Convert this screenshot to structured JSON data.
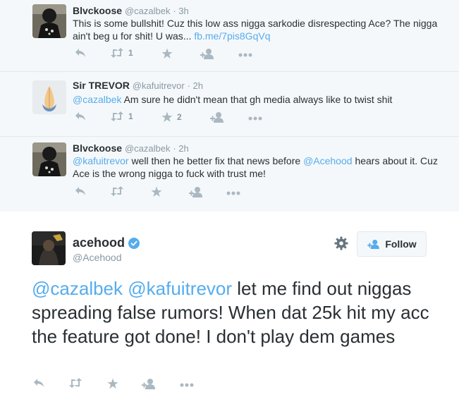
{
  "replies": [
    {
      "name": "Blvckoose",
      "handle": "@cazalbek",
      "time": "· 3h",
      "text_before": "This is some bullshit! Cuz this low ass nigga sarkodie disrespecting Ace? The nigga ain't beg u for shit! U was...",
      "link": "fb.me/7pis8GqVq",
      "retweets": "1",
      "favorites": ""
    },
    {
      "name": "Sir TREVOR",
      "handle": "@kafuitrevor",
      "time": "· 2h",
      "mention": "@cazalbek",
      "text": "Am sure he didn't mean that gh media always like to twist shit",
      "retweets": "1",
      "favorites": "2"
    },
    {
      "name": "Blvckoose",
      "handle": "@cazalbek",
      "time": "· 2h",
      "mention1": "@kafuitrevor",
      "text_mid": "well then he better fix that news before",
      "mention2": "@Acehood",
      "text_end": "hears about it. Cuz Ace is the wrong nigga to fuck with trust me!",
      "retweets": "",
      "favorites": ""
    }
  ],
  "main": {
    "name": "acehood",
    "handle": "@Acehood",
    "follow_label": "Follow",
    "mention1": "@cazalbek",
    "mention2": "@kafuitrevor",
    "text": "let me find out niggas spreading false rumors! When dat 25k hit my acc the feature got done! I don't play dem games"
  },
  "icons": {
    "reply": "reply-icon",
    "retweet": "retweet-icon",
    "favorite": "star-icon",
    "follow": "add-user-icon",
    "more": "more-icon",
    "gear": "gear-icon",
    "verified": "verified-badge-icon"
  },
  "colors": {
    "link": "#55acee",
    "icon": "#aab8c2",
    "secondary_text": "#8899a6",
    "thread_bg": "#f5f8fa"
  }
}
